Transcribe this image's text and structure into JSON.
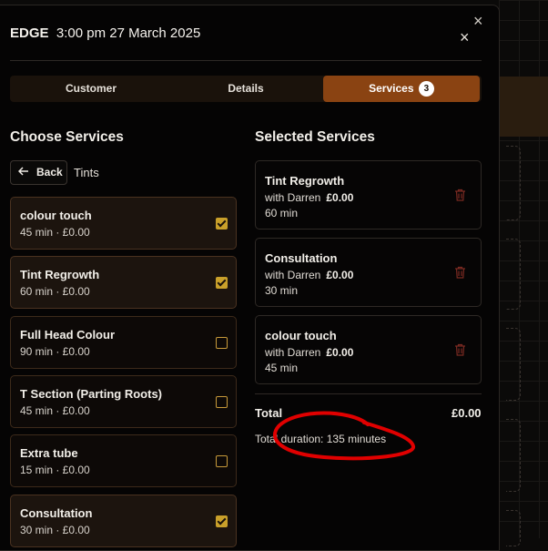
{
  "header": {
    "brand": "EDGE",
    "datetime": "3:00 pm 27 March 2025",
    "close_glyph": "×"
  },
  "outer_close_glyph": "×",
  "tabs": [
    {
      "label": "Customer",
      "active": false
    },
    {
      "label": "Details",
      "active": false
    },
    {
      "label": "Services",
      "active": true,
      "badge": "3"
    }
  ],
  "choose": {
    "heading": "Choose Services",
    "back_label": "Back",
    "category": "Tints",
    "items": [
      {
        "name": "colour touch",
        "meta": "45 min · £0.00",
        "checked": true
      },
      {
        "name": "Tint Regrowth",
        "meta": "60 min · £0.00",
        "checked": true
      },
      {
        "name": "Full Head Colour",
        "meta": "90 min · £0.00",
        "checked": false
      },
      {
        "name": "T Section (Parting Roots)",
        "meta": "45 min · £0.00",
        "checked": false
      },
      {
        "name": "Extra tube",
        "meta": "15 min · £0.00",
        "checked": false
      },
      {
        "name": "Consultation",
        "meta": "30 min · £0.00",
        "checked": true
      }
    ]
  },
  "selected": {
    "heading": "Selected Services",
    "items": [
      {
        "name": "Tint Regrowth",
        "with": "with Darren",
        "price": "£0.00",
        "duration": "60 min"
      },
      {
        "name": "Consultation",
        "with": "with Darren",
        "price": "£0.00",
        "duration": "30 min"
      },
      {
        "name": "colour touch",
        "with": "with Darren",
        "price": "£0.00",
        "duration": "45 min"
      }
    ],
    "total_label": "Total",
    "total_value": "£0.00",
    "duration_text": "Total duration: 135 minutes"
  },
  "colors": {
    "accent": "#8a4312",
    "checkbox": "#c9a02a",
    "trash": "#7a2a22",
    "annotation": "#e00000"
  },
  "icons": {
    "back": "arrow-left-icon",
    "delete": "trash-icon",
    "close": "close-icon",
    "check": "checkbox-icon"
  }
}
